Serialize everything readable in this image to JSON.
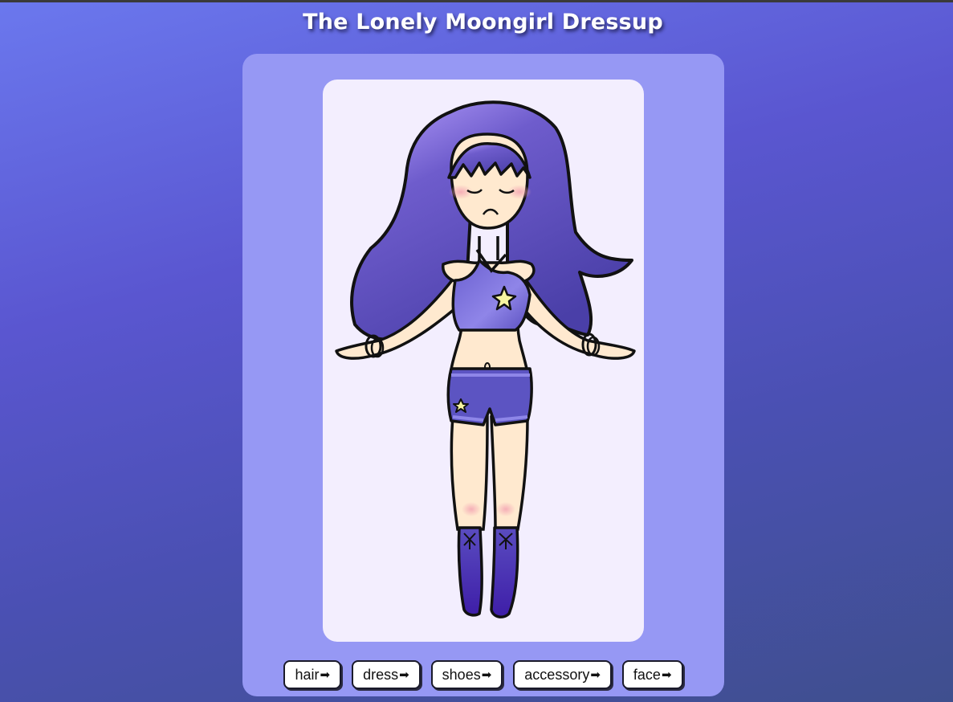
{
  "page": {
    "title": "The Lonely Moongirl Dressup"
  },
  "controls": [
    {
      "label": "hair",
      "arrow": "➡"
    },
    {
      "label": "dress",
      "arrow": "➡"
    },
    {
      "label": "shoes",
      "arrow": "➡"
    },
    {
      "label": "accessory",
      "arrow": "➡"
    },
    {
      "label": "face",
      "arrow": "➡"
    }
  ],
  "colors": {
    "background_top": "#6b78ee",
    "background_bottom": "#3f4f8e",
    "panel": "#9698f4",
    "stage": "#f3eefe",
    "hair": "#5a4ab8",
    "outfit": "#5c54c2",
    "boots": "#4a2aa8",
    "skin": "#ffe9cf"
  },
  "character": {
    "hair": "long-purple-hair",
    "face": "closed-eyes-sad-face",
    "dress": "purple-star-top-and-shorts",
    "shoes": "purple-lace-boots",
    "accessory": "bracelets"
  }
}
